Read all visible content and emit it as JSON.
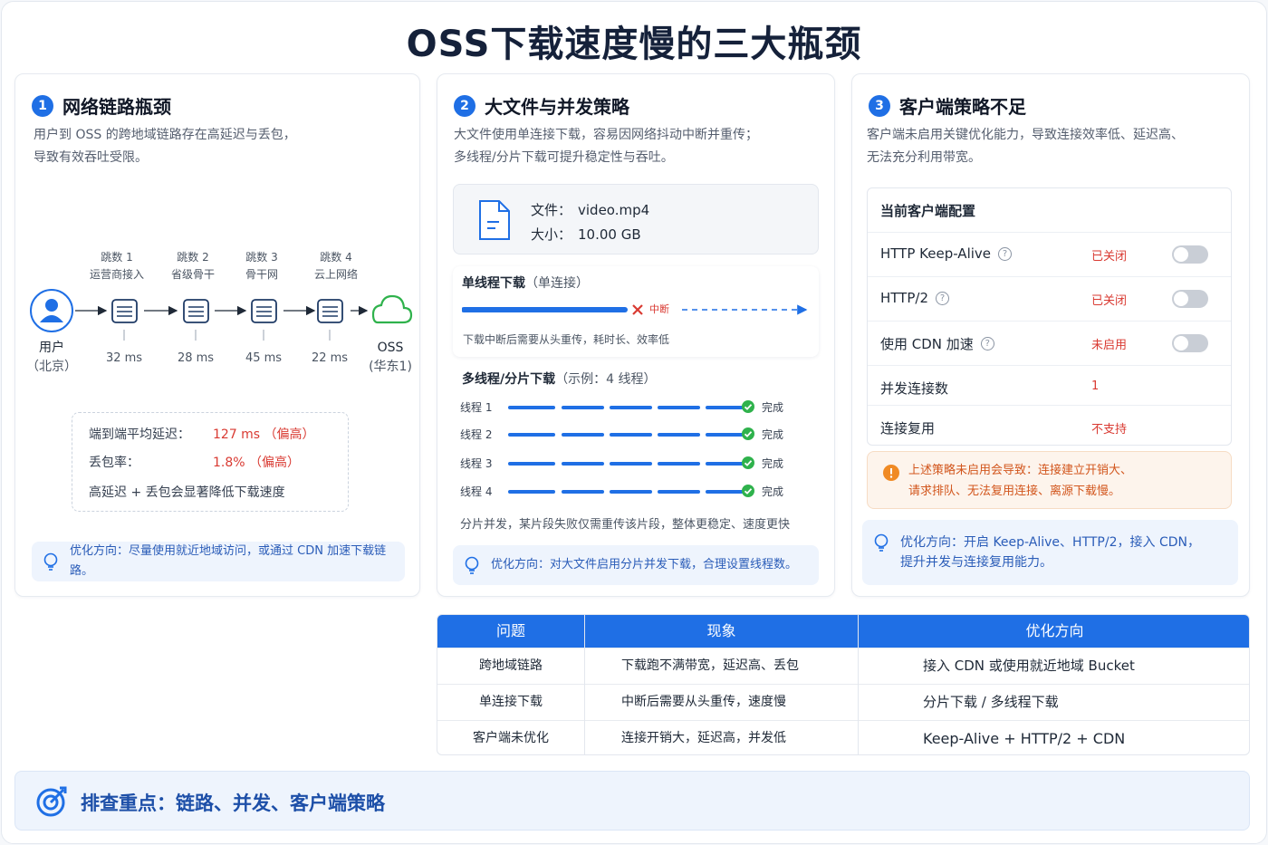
{
  "title": "OSS下载速度慢的三大瓶颈",
  "colors": {
    "accent": "#1f6fe5",
    "danger": "#d93a32",
    "warning": "#d2561d"
  },
  "card1": {
    "num": "1",
    "title": "网络链路瓶颈",
    "desc_line1": "用户到 OSS 的跨地域链路存在高延迟与丢包，",
    "desc_line2": "导致有效吞吐受限。",
    "user_label": "用户",
    "user_sub": "（北京）",
    "oss_label": "OSS",
    "oss_sub": "(华东1)",
    "hops": [
      {
        "title": "跳数 1",
        "name": "运营商接入",
        "ms": "32 ms"
      },
      {
        "title": "跳数 2",
        "name": "省级骨干",
        "ms": "28 ms"
      },
      {
        "title": "跳数 3",
        "name": "骨干网",
        "ms": "45 ms"
      },
      {
        "title": "跳数 4",
        "name": "云上网络",
        "ms": "22 ms"
      }
    ],
    "latency_label": "端到端平均延迟：",
    "latency_value": "127 ms （偏高）",
    "loss_label": "丢包率：",
    "loss_value": "1.8%  （偏高）",
    "summary": "高延迟 + 丢包会显著降低下载速度",
    "tip": "优化方向：尽量使用就近地域访问，或通过 CDN 加速下载链路。"
  },
  "card2": {
    "num": "2",
    "title": "大文件与并发策略",
    "desc_line1": "大文件使用单连接下载，容易因网络抖动中断并重传；",
    "desc_line2": "多线程/分片下载可提升稳定性与吞吐。",
    "file_key": "文件：",
    "file_val": "video.mp4",
    "size_key": "大小：",
    "size_val": "10.00 GB",
    "single_title": "单线程下载",
    "single_sub": "（单连接）",
    "interrupt_label": "中断",
    "single_note": "下载中断后需要从头重传，耗时长、效率低",
    "multi_title": "多线程/分片下载",
    "multi_sub": "（示例：4 线程）",
    "threads": [
      {
        "label": "线程 1",
        "status": "完成"
      },
      {
        "label": "线程 2",
        "status": "完成"
      },
      {
        "label": "线程 3",
        "status": "完成"
      },
      {
        "label": "线程 4",
        "status": "完成"
      }
    ],
    "multi_note": "分片并发，某片段失败仅需重传该片段，整体更稳定、速度更快",
    "tip": "优化方向：对大文件启用分片并发下载，合理设置线程数。"
  },
  "card3": {
    "num": "3",
    "title": "客户端策略不足",
    "desc_line1": "客户端未启用关键优化能力，导致连接效率低、延迟高、",
    "desc_line2": "无法充分利用带宽。",
    "config_title": "当前客户端配置",
    "rows": [
      {
        "name": "HTTP Keep-Alive",
        "value": "已关闭",
        "help": true,
        "toggle": true
      },
      {
        "name": "HTTP/2",
        "value": "已关闭",
        "help": true,
        "toggle": true
      },
      {
        "name": "使用 CDN 加速",
        "value": "未启用",
        "help": true,
        "toggle": true
      },
      {
        "name": "并发连接数",
        "value": "1",
        "help": false,
        "toggle": false
      },
      {
        "name": "连接复用",
        "value": "不支持",
        "help": false,
        "toggle": false
      }
    ],
    "warn_line1": "上述策略未启用会导致：连接建立开销大、",
    "warn_line2": "请求排队、无法复用连接、离源下载慢。",
    "tip_line1": "优化方向：开启 Keep-Alive、HTTP/2，接入 CDN，",
    "tip_line2": "提升并发与连接复用能力。"
  },
  "table": {
    "headers": [
      "问题",
      "现象",
      "优化方向"
    ],
    "rows": [
      [
        "跨地域链路",
        "下载跑不满带宽，延迟高、丢包",
        "接入 CDN 或使用就近地域 Bucket"
      ],
      [
        "单连接下载",
        "中断后需要从头重传，速度慢",
        "分片下载 / 多线程下载"
      ],
      [
        "客户端未优化",
        "连接开销大，延迟高，并发低",
        "Keep-Alive + HTTP/2 + CDN"
      ]
    ]
  },
  "bottom": "排查重点：链路、并发、客户端策略"
}
